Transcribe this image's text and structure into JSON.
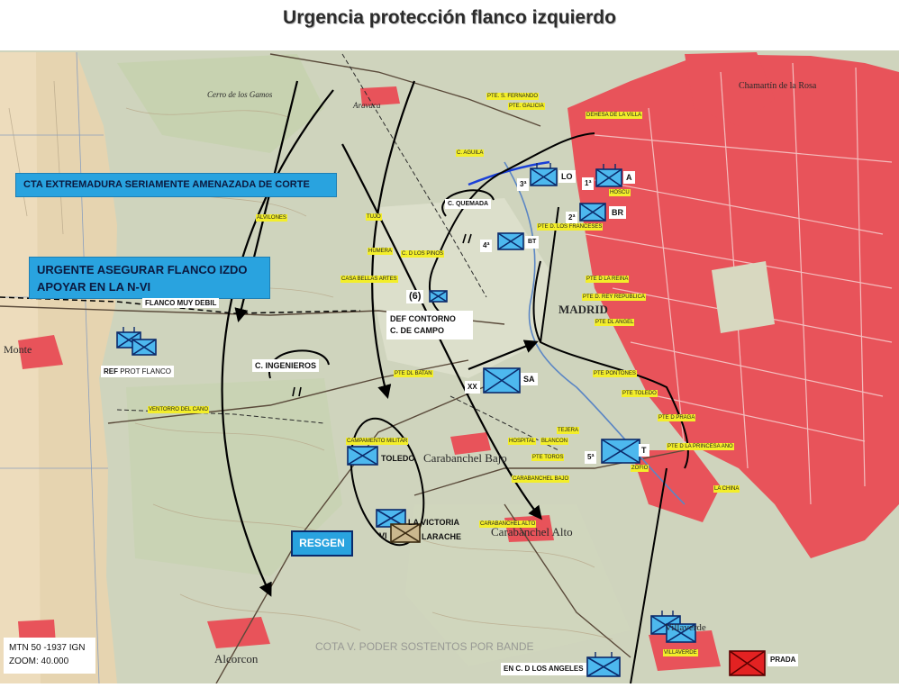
{
  "title": "Urgencia protección flanco izquierdo",
  "colors": {
    "banner": "#29a3df",
    "urban": "#e8535a",
    "enemy": "#e32222",
    "friendly": "#4db8ee",
    "reserve": "#cbb88e"
  },
  "banners": {
    "cta": "CTA EXTREMADURA SERIAMENTE AMENAZADA DE CORTE",
    "urgente_line1": "URGENTE ASEGURAR FLANCO IZDO",
    "urgente_line2": "APOYAR EN LA N-VI"
  },
  "notes": {
    "flanco_debil": "FLANCO MUY DEBIL",
    "def_contorno_line1": "DEF CONTORNO",
    "def_contorno_line2": "C. DE CAMPO",
    "ingenieros": "C.  INGENIEROS",
    "quemada": "C. QUEMADA",
    "ref": "REF",
    "prot_flanco": "PROT FLANCO",
    "resgen": "RESGEN"
  },
  "unit_labels": {
    "lo": "LO",
    "tercera": "3ª",
    "a": "A",
    "primera": "1ª",
    "br": "BR",
    "segunda": "2ª",
    "bt": "BT",
    "cuarta": "4ª",
    "seis": "(6)",
    "xx": "XX",
    "sa": "SA",
    "t": "T",
    "quinta": "5ª",
    "toledo": "TOLEDO",
    "la_victoria": "LA VICTORIA",
    "vi": "VI",
    "larache": "LARACHE",
    "los_angeles": "EN C. D LOS ANGELES",
    "prada": "PRADA"
  },
  "places": [
    {
      "name": "Aravaca"
    },
    {
      "name": "Carabanchel Bajo"
    },
    {
      "name": "Carabanchel Alto"
    },
    {
      "name": "Villaverde"
    },
    {
      "name": "MADRID"
    },
    {
      "name": "Monte"
    },
    {
      "name": "Alcorcon"
    },
    {
      "name": "Chamartín de la Rosa"
    },
    {
      "name": "Cerro de los Gamos"
    }
  ],
  "yellow_labels": [
    "PTE. S. FERNANDO",
    "PTE. GALICIA",
    "DEHESA DE LA VILLA",
    "C. AGUILA",
    "HOSCU",
    "PTE D. LOS FRANCESES",
    "HUMERA",
    "C. D LOS PINOS",
    "CASA BELLAS ARTES",
    "PTE D LA REINA",
    "PTE D. REY REPUBLICA",
    "PTE DL ANGEL",
    "PTE DL BATAN",
    "PTE PONTONES",
    "PTE TOLEDO",
    "VENTORRO DEL CANO",
    "CAMPAMENTO MILITAR",
    "PTE D PRAGA",
    "PTE D LA PRINCESA ANO",
    "PTE TOROS",
    "ZOFIO",
    "LA CHINA",
    "CARABANCHEL BAJO",
    "CARABANCHEL ALTO",
    "VILLAVERDE",
    "BLANCON",
    "HOSPITAL",
    "TEJERA",
    "TUJO",
    "ALVILONES"
  ],
  "faded_caption": "COTA V. PODER SOSTENTOS POR BANDE",
  "map_info": {
    "line1": "MTN 50 -1937 IGN",
    "line2": "ZOOM: 40.000"
  }
}
